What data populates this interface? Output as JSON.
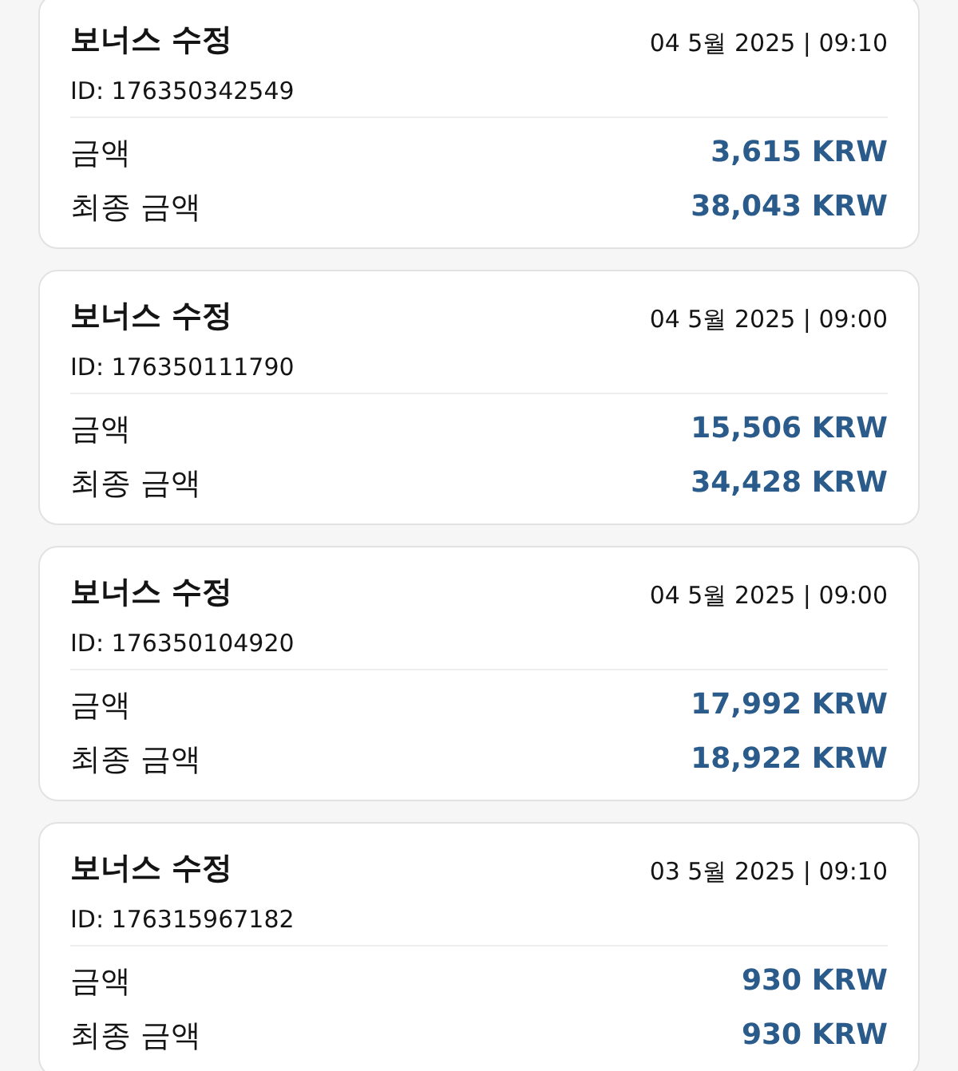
{
  "cards": [
    {
      "title": "보너스 수정",
      "datetime": "04 5월 2025 | 09:10",
      "id": "ID: 176350342549",
      "rows": [
        {
          "label": "금액",
          "value": "3,615 KRW"
        },
        {
          "label": "최종 금액",
          "value": "38,043 KRW"
        }
      ]
    },
    {
      "title": "보너스 수정",
      "datetime": "04 5월 2025 | 09:00",
      "id": "ID: 176350111790",
      "rows": [
        {
          "label": "금액",
          "value": "15,506 KRW"
        },
        {
          "label": "최종 금액",
          "value": "34,428 KRW"
        }
      ]
    },
    {
      "title": "보너스 수정",
      "datetime": "04 5월 2025 | 09:00",
      "id": "ID: 176350104920",
      "rows": [
        {
          "label": "금액",
          "value": "17,992 KRW"
        },
        {
          "label": "최종 금액",
          "value": "18,922 KRW"
        }
      ]
    },
    {
      "title": "보너스 수정",
      "datetime": "03 5월 2025 | 09:10",
      "id": "ID: 176315967182",
      "rows": [
        {
          "label": "금액",
          "value": "930 KRW"
        },
        {
          "label": "최종 금액",
          "value": "930 KRW"
        }
      ]
    }
  ]
}
